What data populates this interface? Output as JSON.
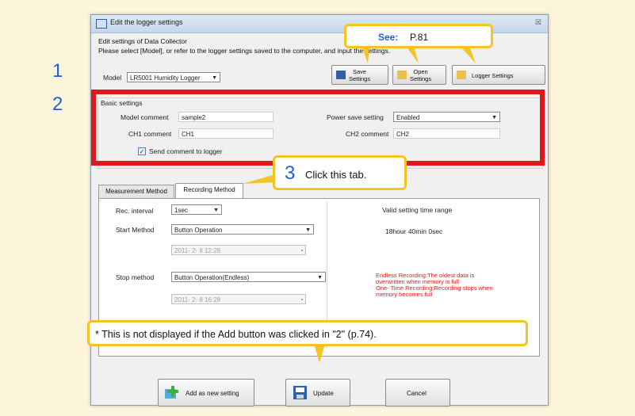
{
  "window": {
    "title": "Edit the logger settings",
    "close": "☒"
  },
  "description": {
    "line1": "Edit settings of Data Collector",
    "line2": "Please select [Model], or refer to the logger settings saved to the computer, and input the settings."
  },
  "model": {
    "label": "Model",
    "value": "LR5001 Humidity Logger"
  },
  "toolbar": {
    "save": {
      "line1": "Save",
      "line2": "Settings"
    },
    "open": {
      "line1": "Open",
      "line2": "Settings"
    },
    "logger": "Logger Settings"
  },
  "basic_settings": {
    "title": "Basic settings",
    "model_comment_label": "Model comment",
    "model_comment_value": "sample2",
    "ch1_label": "CH1 comment",
    "ch1_value": "CH1",
    "power_save_label": "Power save setting",
    "power_save_value": "Enabled",
    "ch2_label": "CH2 comment",
    "ch2_value": "CH2",
    "send_comment_label": "Send comment to logger",
    "send_comment_checked": true
  },
  "tabs": [
    {
      "label": "Measurement Method",
      "active": false
    },
    {
      "label": "Recording Method",
      "active": true
    }
  ],
  "recording": {
    "rec_interval_label": "Rec. interval",
    "rec_interval_value": "1sec",
    "start_method_label": "Start Method",
    "start_method_value": "Button Operation",
    "start_date": "2011- 2- 8 12:28",
    "stop_method_label": "Stop method",
    "stop_method_value": "Button Operation(Endless)",
    "stop_date": "2011- 2- 8 16:28",
    "valid_range_label": "Valid setting time range",
    "valid_range_value": "18hour 40min 0sec",
    "notes": [
      "Endless Recording:The oldest data is",
      "overwritten when memory is full",
      "One- Time Recording:Recording stops when",
      "memory becomes full"
    ]
  },
  "buttons": {
    "add": "Add as new setting",
    "update": "Update",
    "cancel": "Cancel"
  },
  "annotations": {
    "step1": "1",
    "step2": "2",
    "step3": "3",
    "see_label": "See:",
    "see_page": "P.81",
    "tab_instruction": "Click this tab.",
    "footnote": "* This is not displayed if the Add button was clicked in \"2\" (p.74)."
  },
  "colors": {
    "highlight_red": "#e0181b",
    "callout_yellow": "#f4c324",
    "step_blue": "#1f5fd6",
    "page_background": "#fdf4dc"
  }
}
